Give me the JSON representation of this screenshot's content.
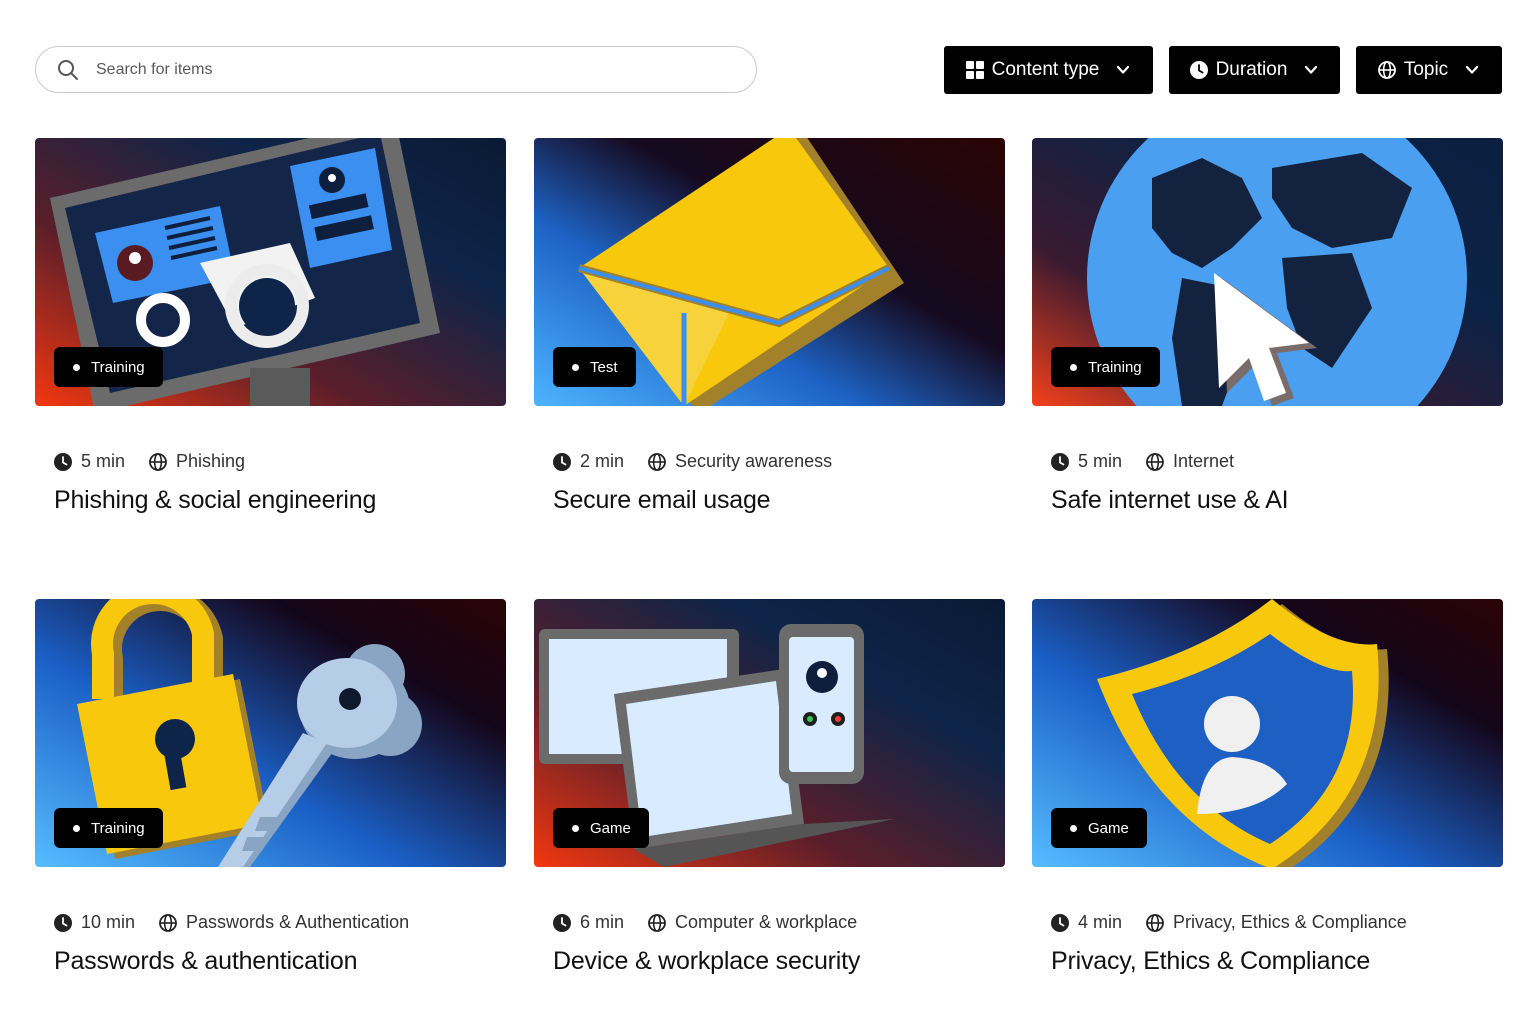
{
  "search": {
    "placeholder": "Search for items",
    "value": ""
  },
  "filters": {
    "content_type": "Content type",
    "duration": "Duration",
    "topic": "Topic"
  },
  "colors": {
    "badge_bg": "#000000",
    "card_gradient": [
      "#f03a17",
      "#3aa6f5",
      "#0b1e3b",
      "#2a0608"
    ],
    "accent_yellow": "#f8c80d"
  },
  "cards": [
    {
      "badge": "Training",
      "duration": "5 min",
      "topic": "Phishing",
      "title": "Phishing & social engineering",
      "illustration": "computer-monitor-phishing"
    },
    {
      "badge": "Test",
      "duration": "2 min",
      "topic": "Security awareness",
      "title": "Secure email usage",
      "illustration": "envelope"
    },
    {
      "badge": "Training",
      "duration": "5 min",
      "topic": "Internet",
      "title": "Safe internet use & AI",
      "illustration": "globe-cursor"
    },
    {
      "badge": "Training",
      "duration": "10 min",
      "topic": "Passwords & Authentication",
      "title": "Passwords & authentication",
      "illustration": "padlock-key"
    },
    {
      "badge": "Game",
      "duration": "6 min",
      "topic": "Computer & workplace",
      "title": "Device & workplace security",
      "illustration": "devices"
    },
    {
      "badge": "Game",
      "duration": "4 min",
      "topic": "Privacy, Ethics & Compliance",
      "title": "Privacy, Ethics & Compliance",
      "illustration": "shield-user"
    }
  ]
}
